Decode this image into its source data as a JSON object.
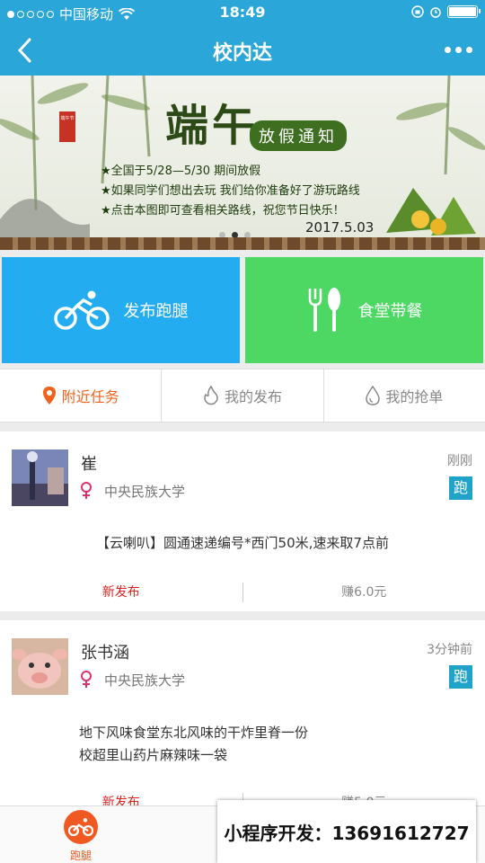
{
  "status_bar": {
    "carrier": "中国移动",
    "time": "18:49"
  },
  "nav": {
    "title": "校内达"
  },
  "banner": {
    "title": "端午",
    "subtitle": "放假通知",
    "seal": "端午节",
    "lines": [
      "★全国于5/28—5/30 期间放假",
      "★如果同学们想出去玩 我们给你准备好了游玩路线",
      "★点击本图即可查看相关路线，祝您节日快乐！"
    ],
    "date": "2017.5.03"
  },
  "actions": {
    "run": "发布跑腿",
    "food": "食堂带餐"
  },
  "tabs": [
    {
      "label": "附近任务"
    },
    {
      "label": "我的发布"
    },
    {
      "label": "我的抢单"
    }
  ],
  "tasks": [
    {
      "name": "崔",
      "school": "中央民族大学",
      "time": "刚刚",
      "badge": "跑",
      "content": [
        "【云喇叭】圆通速递编号*西门50米,速来取7点前"
      ],
      "status": "新发布",
      "earn": "赚6.0元"
    },
    {
      "name": "张书涵",
      "school": "中央民族大学",
      "time": "3分钟前",
      "badge": "跑",
      "content": [
        "地下风味食堂东北风味的干炸里脊一份",
        "校超里山药片麻辣味一袋"
      ],
      "status": "新发布",
      "earn": "赚5.0元"
    }
  ],
  "bottom_nav": {
    "home": "跑腿"
  },
  "promo": "小程序开发：13691612727",
  "colors": {
    "primary": "#2aa7d8",
    "run_blue": "#23acef",
    "food_green": "#4cd863",
    "active_orange": "#f0631e",
    "status_red": "#d22222"
  }
}
